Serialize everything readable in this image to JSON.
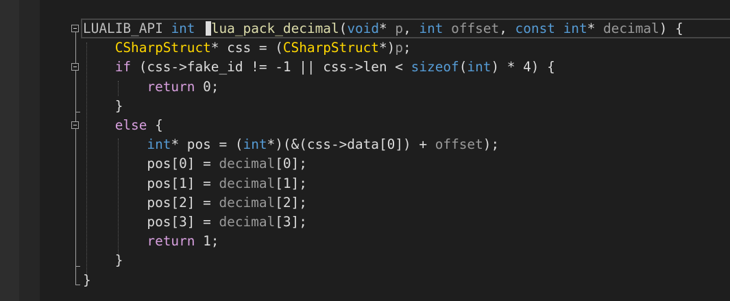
{
  "editor": {
    "lines": [
      [
        {
          "t": "LUALIB_API",
          "c": "macro"
        },
        {
          "t": " ",
          "c": "pl"
        },
        {
          "t": "int",
          "c": "kw"
        },
        {
          "t": "  ",
          "c": "pl"
        },
        {
          "t": "lua_pack_decimal",
          "c": "fn"
        },
        {
          "t": "(",
          "c": "pl"
        },
        {
          "t": "void",
          "c": "kw"
        },
        {
          "t": "* ",
          "c": "pl"
        },
        {
          "t": "p",
          "c": "param"
        },
        {
          "t": ", ",
          "c": "pl"
        },
        {
          "t": "int",
          "c": "kw"
        },
        {
          "t": " ",
          "c": "pl"
        },
        {
          "t": "offset",
          "c": "param"
        },
        {
          "t": ", ",
          "c": "pl"
        },
        {
          "t": "const",
          "c": "kw"
        },
        {
          "t": " ",
          "c": "pl"
        },
        {
          "t": "int",
          "c": "kw"
        },
        {
          "t": "* ",
          "c": "pl"
        },
        {
          "t": "decimal",
          "c": "param"
        },
        {
          "t": ") {",
          "c": "pl"
        }
      ],
      [
        {
          "t": "    ",
          "c": "pl"
        },
        {
          "t": "CSharpStruct",
          "c": "struct"
        },
        {
          "t": "* css = (",
          "c": "pl"
        },
        {
          "t": "CSharpStruct",
          "c": "struct"
        },
        {
          "t": "*)",
          "c": "pl"
        },
        {
          "t": "p",
          "c": "param"
        },
        {
          "t": ";",
          "c": "pl"
        }
      ],
      [
        {
          "t": "    ",
          "c": "pl"
        },
        {
          "t": "if",
          "c": "ctl"
        },
        {
          "t": " (css->fake_id != -1 || css->len < ",
          "c": "pl"
        },
        {
          "t": "sizeof",
          "c": "kw"
        },
        {
          "t": "(",
          "c": "pl"
        },
        {
          "t": "int",
          "c": "kw"
        },
        {
          "t": ") * 4) {",
          "c": "pl"
        }
      ],
      [
        {
          "t": "        ",
          "c": "pl"
        },
        {
          "t": "return",
          "c": "ctl"
        },
        {
          "t": " 0;",
          "c": "pl"
        }
      ],
      [
        {
          "t": "    }",
          "c": "pl"
        }
      ],
      [
        {
          "t": "    ",
          "c": "pl"
        },
        {
          "t": "else",
          "c": "ctl"
        },
        {
          "t": " {",
          "c": "pl"
        }
      ],
      [
        {
          "t": "        ",
          "c": "pl"
        },
        {
          "t": "int",
          "c": "kw"
        },
        {
          "t": "* pos = (",
          "c": "pl"
        },
        {
          "t": "int",
          "c": "kw"
        },
        {
          "t": "*)(&(css->data[0]) + ",
          "c": "pl"
        },
        {
          "t": "offset",
          "c": "param"
        },
        {
          "t": ");",
          "c": "pl"
        }
      ],
      [
        {
          "t": "        pos[0] = ",
          "c": "pl"
        },
        {
          "t": "decimal",
          "c": "param"
        },
        {
          "t": "[0];",
          "c": "pl"
        }
      ],
      [
        {
          "t": "        pos[1] = ",
          "c": "pl"
        },
        {
          "t": "decimal",
          "c": "param"
        },
        {
          "t": "[1];",
          "c": "pl"
        }
      ],
      [
        {
          "t": "        pos[2] = ",
          "c": "pl"
        },
        {
          "t": "decimal",
          "c": "param"
        },
        {
          "t": "[2];",
          "c": "pl"
        }
      ],
      [
        {
          "t": "        pos[3] = ",
          "c": "pl"
        },
        {
          "t": "decimal",
          "c": "param"
        },
        {
          "t": "[3];",
          "c": "pl"
        }
      ],
      [
        {
          "t": "        ",
          "c": "pl"
        },
        {
          "t": "return",
          "c": "ctl"
        },
        {
          "t": " 1;",
          "c": "pl"
        }
      ],
      [
        {
          "t": "    }",
          "c": "pl"
        }
      ],
      [
        {
          "t": "}",
          "c": "pl"
        }
      ]
    ]
  }
}
